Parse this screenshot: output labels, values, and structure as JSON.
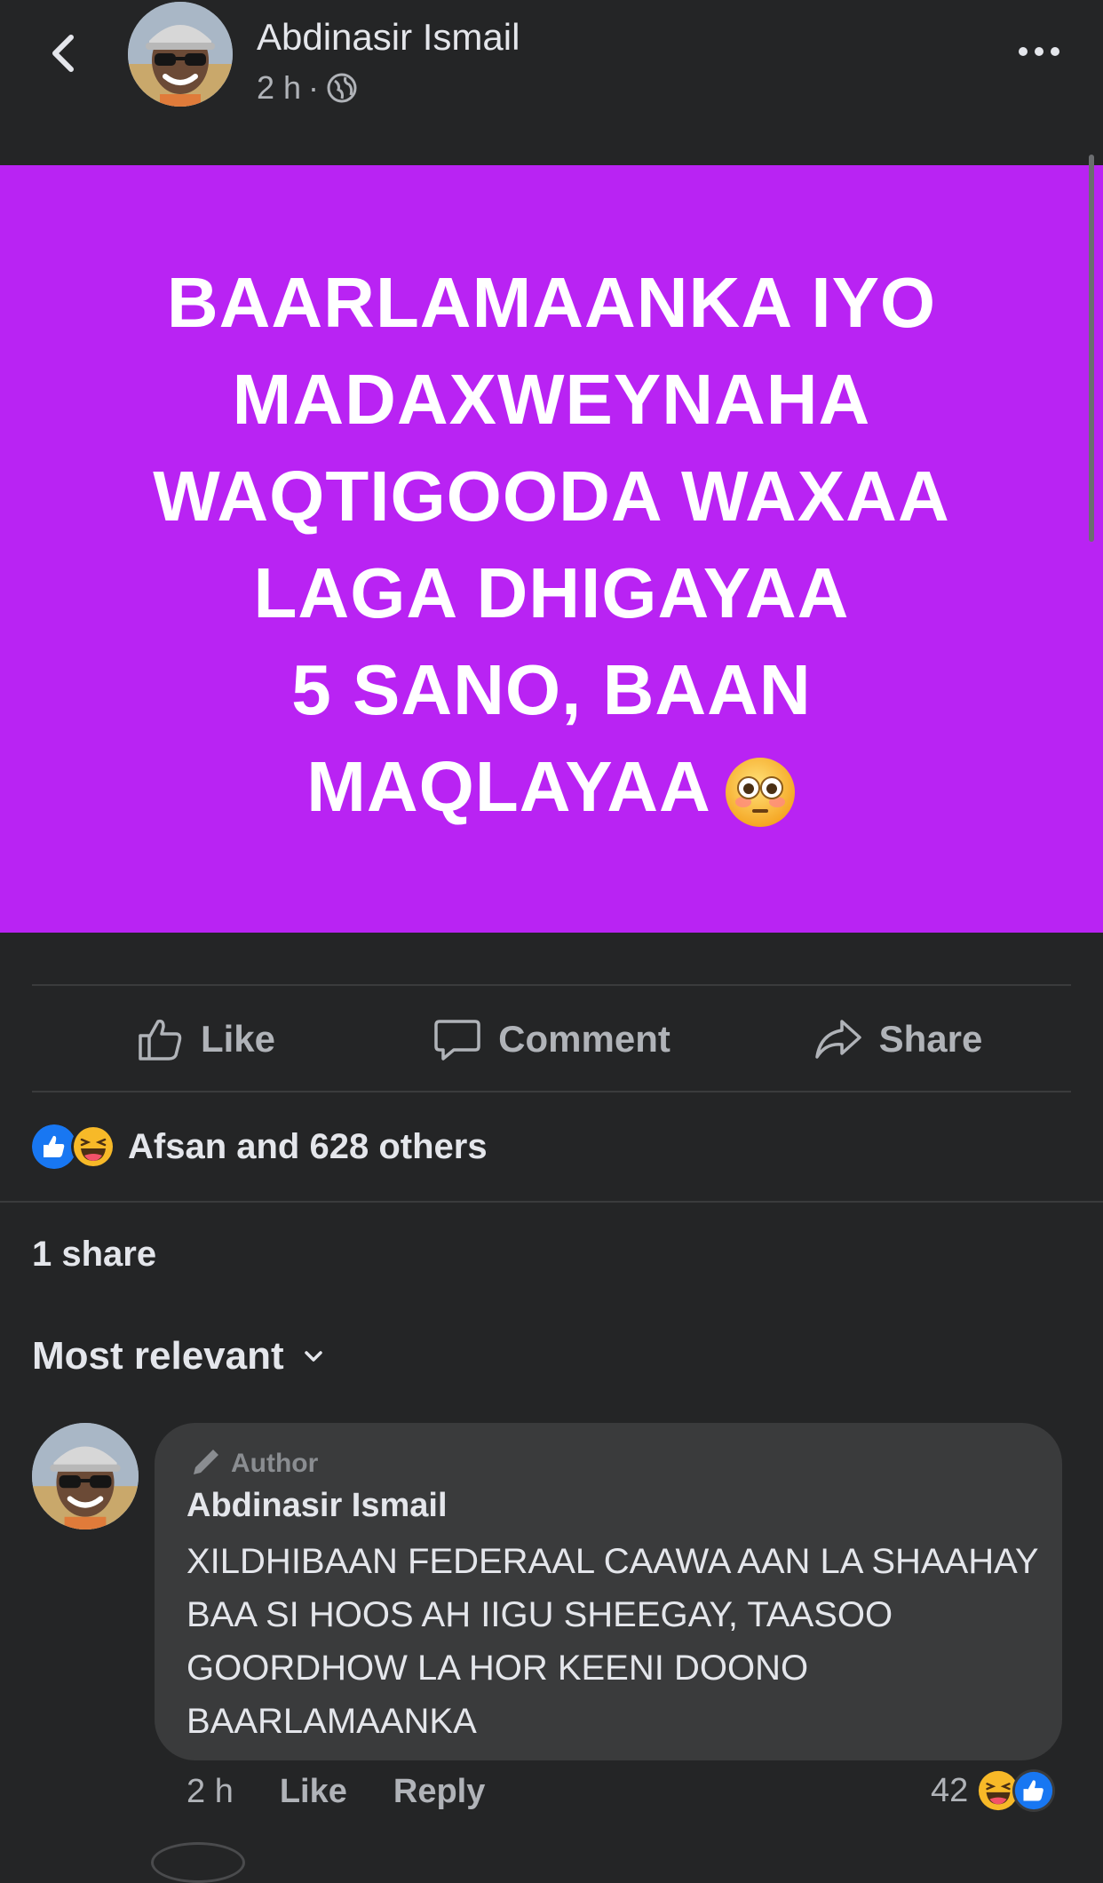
{
  "header": {
    "author_name": "Abdinasir Ismail",
    "time": "2 h",
    "separator": "·",
    "audience_icon": "globe-icon",
    "back_icon": "chevron-left-icon",
    "more_icon": "more-horizontal-icon"
  },
  "post": {
    "background_color": "#b923f3",
    "lines": [
      "BAARLAMAANKA IYO",
      "MADAXWEYNAHA",
      "WAQTIGOODA WAXAA",
      "LAGA DHIGAYAA",
      "5 SANO, BAAN",
      "MAQLAYAA"
    ],
    "trailing_emoji": "flushed-face-emoji"
  },
  "actions": {
    "like": "Like",
    "comment": "Comment",
    "share": "Share"
  },
  "reactions": {
    "summary": "Afsan and 628 others",
    "icons": [
      "like-reaction-icon",
      "haha-reaction-icon"
    ]
  },
  "shares": {
    "count_text": "1 share"
  },
  "comments_filter": {
    "label": "Most relevant"
  },
  "comment": {
    "badge": "Author",
    "name": "Abdinasir Ismail",
    "text": "XILDHIBAAN FEDERAAL CAAWA AAN LA SHAAHAY BAA SI HOOS AH IIGU SHEEGAY, TAASOO GOORDHOW LA HOR KEENI DOONO BAARLAMAANKA",
    "time": "2 h",
    "like": "Like",
    "reply": "Reply",
    "reaction_count": "42"
  },
  "colors": {
    "background": "#242526",
    "bubble": "#3a3b3c",
    "muted_text": "#b0b3b8",
    "like_blue": "#1877f2",
    "haha_yellow": "#f7b928"
  }
}
